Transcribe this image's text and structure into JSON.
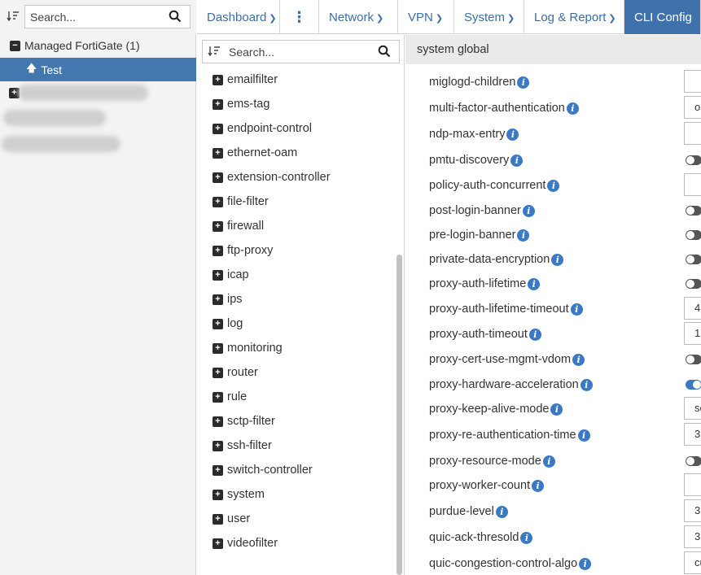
{
  "left": {
    "search_placeholder": "Search...",
    "root_label": "Managed FortiGate (1)",
    "selected_label": "Test"
  },
  "nav": {
    "dashboard": "Dashboard",
    "network": "Network",
    "vpn": "VPN",
    "system": "System",
    "log_report": "Log & Report",
    "cli": "CLI Config"
  },
  "middle": {
    "search_placeholder": "Search...",
    "items": [
      "emailfilter",
      "ems-tag",
      "endpoint-control",
      "ethernet-oam",
      "extension-controller",
      "file-filter",
      "firewall",
      "ftp-proxy",
      "icap",
      "ips",
      "log",
      "monitoring",
      "router",
      "rule",
      "sctp-filter",
      "ssh-filter",
      "switch-controller",
      "system",
      "user",
      "videofilter"
    ]
  },
  "right": {
    "header": "system global",
    "settings": [
      {
        "label": "miglogd-children",
        "control": "input",
        "value": ""
      },
      {
        "label": "multi-factor-authentication",
        "control": "select",
        "value": "op"
      },
      {
        "label": "ndp-max-entry",
        "control": "input",
        "value": ""
      },
      {
        "label": "pmtu-discovery",
        "control": "toggle",
        "on": false
      },
      {
        "label": "policy-auth-concurrent",
        "control": "input",
        "value": ""
      },
      {
        "label": "post-login-banner",
        "control": "toggle",
        "on": false
      },
      {
        "label": "pre-login-banner",
        "control": "toggle",
        "on": false
      },
      {
        "label": "private-data-encryption",
        "control": "toggle",
        "on": false
      },
      {
        "label": "proxy-auth-lifetime",
        "control": "toggle",
        "on": false
      },
      {
        "label": "proxy-auth-lifetime-timeout",
        "control": "input",
        "value": "4"
      },
      {
        "label": "proxy-auth-timeout",
        "control": "input",
        "value": "1"
      },
      {
        "label": "proxy-cert-use-mgmt-vdom",
        "control": "toggle",
        "on": false
      },
      {
        "label": "proxy-hardware-acceleration",
        "control": "toggle",
        "on": true
      },
      {
        "label": "proxy-keep-alive-mode",
        "control": "select",
        "value": "se"
      },
      {
        "label": "proxy-re-authentication-time",
        "control": "input",
        "value": "3"
      },
      {
        "label": "proxy-resource-mode",
        "control": "toggle",
        "on": false
      },
      {
        "label": "proxy-worker-count",
        "control": "input",
        "value": ""
      },
      {
        "label": "purdue-level",
        "control": "select",
        "value": "3"
      },
      {
        "label": "quic-ack-thresold",
        "control": "input",
        "value": "3"
      },
      {
        "label": "quic-congestion-control-algo",
        "control": "select",
        "value": "cu"
      }
    ]
  }
}
